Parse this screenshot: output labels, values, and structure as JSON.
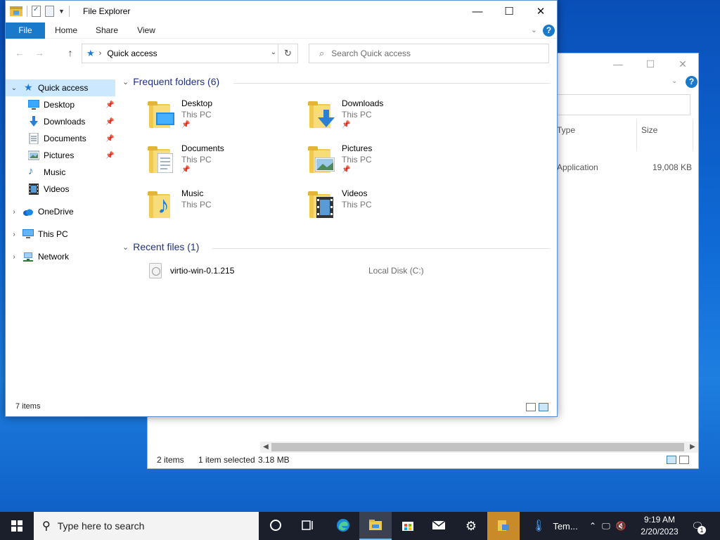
{
  "background_window": {
    "column_type": "Type",
    "column_size": "Size",
    "row_type": "Application",
    "row_size": "19,008 KB",
    "status_items": "2 items",
    "status_selected": "1 item selected",
    "status_size": "3.18 MB"
  },
  "window": {
    "title": "File Explorer",
    "minimize": "—",
    "maximize": "☐",
    "close": "✕"
  },
  "ribbon": {
    "tabs": [
      "File",
      "Home",
      "Share",
      "View"
    ],
    "help": "?"
  },
  "navbar": {
    "back": "←",
    "forward": "→",
    "up": "↑",
    "address": "Quick access",
    "refresh": "↻",
    "search_placeholder": "Search Quick access"
  },
  "sidebar": {
    "quick_access": "Quick access",
    "pinned": [
      {
        "label": "Desktop",
        "icon": "desktop-icon"
      },
      {
        "label": "Downloads",
        "icon": "downloads-icon"
      },
      {
        "label": "Documents",
        "icon": "documents-icon"
      },
      {
        "label": "Pictures",
        "icon": "pictures-icon"
      },
      {
        "label": "Music",
        "icon": "music-icon"
      },
      {
        "label": "Videos",
        "icon": "videos-icon"
      }
    ],
    "onedrive": "OneDrive",
    "this_pc": "This PC",
    "network": "Network"
  },
  "content": {
    "frequent_header": "Frequent folders (6)",
    "folders": [
      {
        "name": "Desktop",
        "location": "This PC",
        "pinned": true
      },
      {
        "name": "Downloads",
        "location": "This PC",
        "pinned": true
      },
      {
        "name": "Documents",
        "location": "This PC",
        "pinned": true
      },
      {
        "name": "Pictures",
        "location": "This PC",
        "pinned": true
      },
      {
        "name": "Music",
        "location": "This PC",
        "pinned": false
      },
      {
        "name": "Videos",
        "location": "This PC",
        "pinned": false
      }
    ],
    "recent_header": "Recent files (1)",
    "recent": [
      {
        "name": "virtio-win-0.1.215",
        "location": "Local Disk (C:)"
      }
    ]
  },
  "status": {
    "items": "7 items"
  },
  "taskbar": {
    "search_text": "Type here to search",
    "weather": "Tem...",
    "time": "9:19 AM",
    "date": "2/20/2023",
    "notification_count": "1"
  },
  "colors": {
    "accent": "#1979ca",
    "selection": "#cce8ff",
    "section_header": "#1e3287",
    "folder": "#f2c94f"
  }
}
